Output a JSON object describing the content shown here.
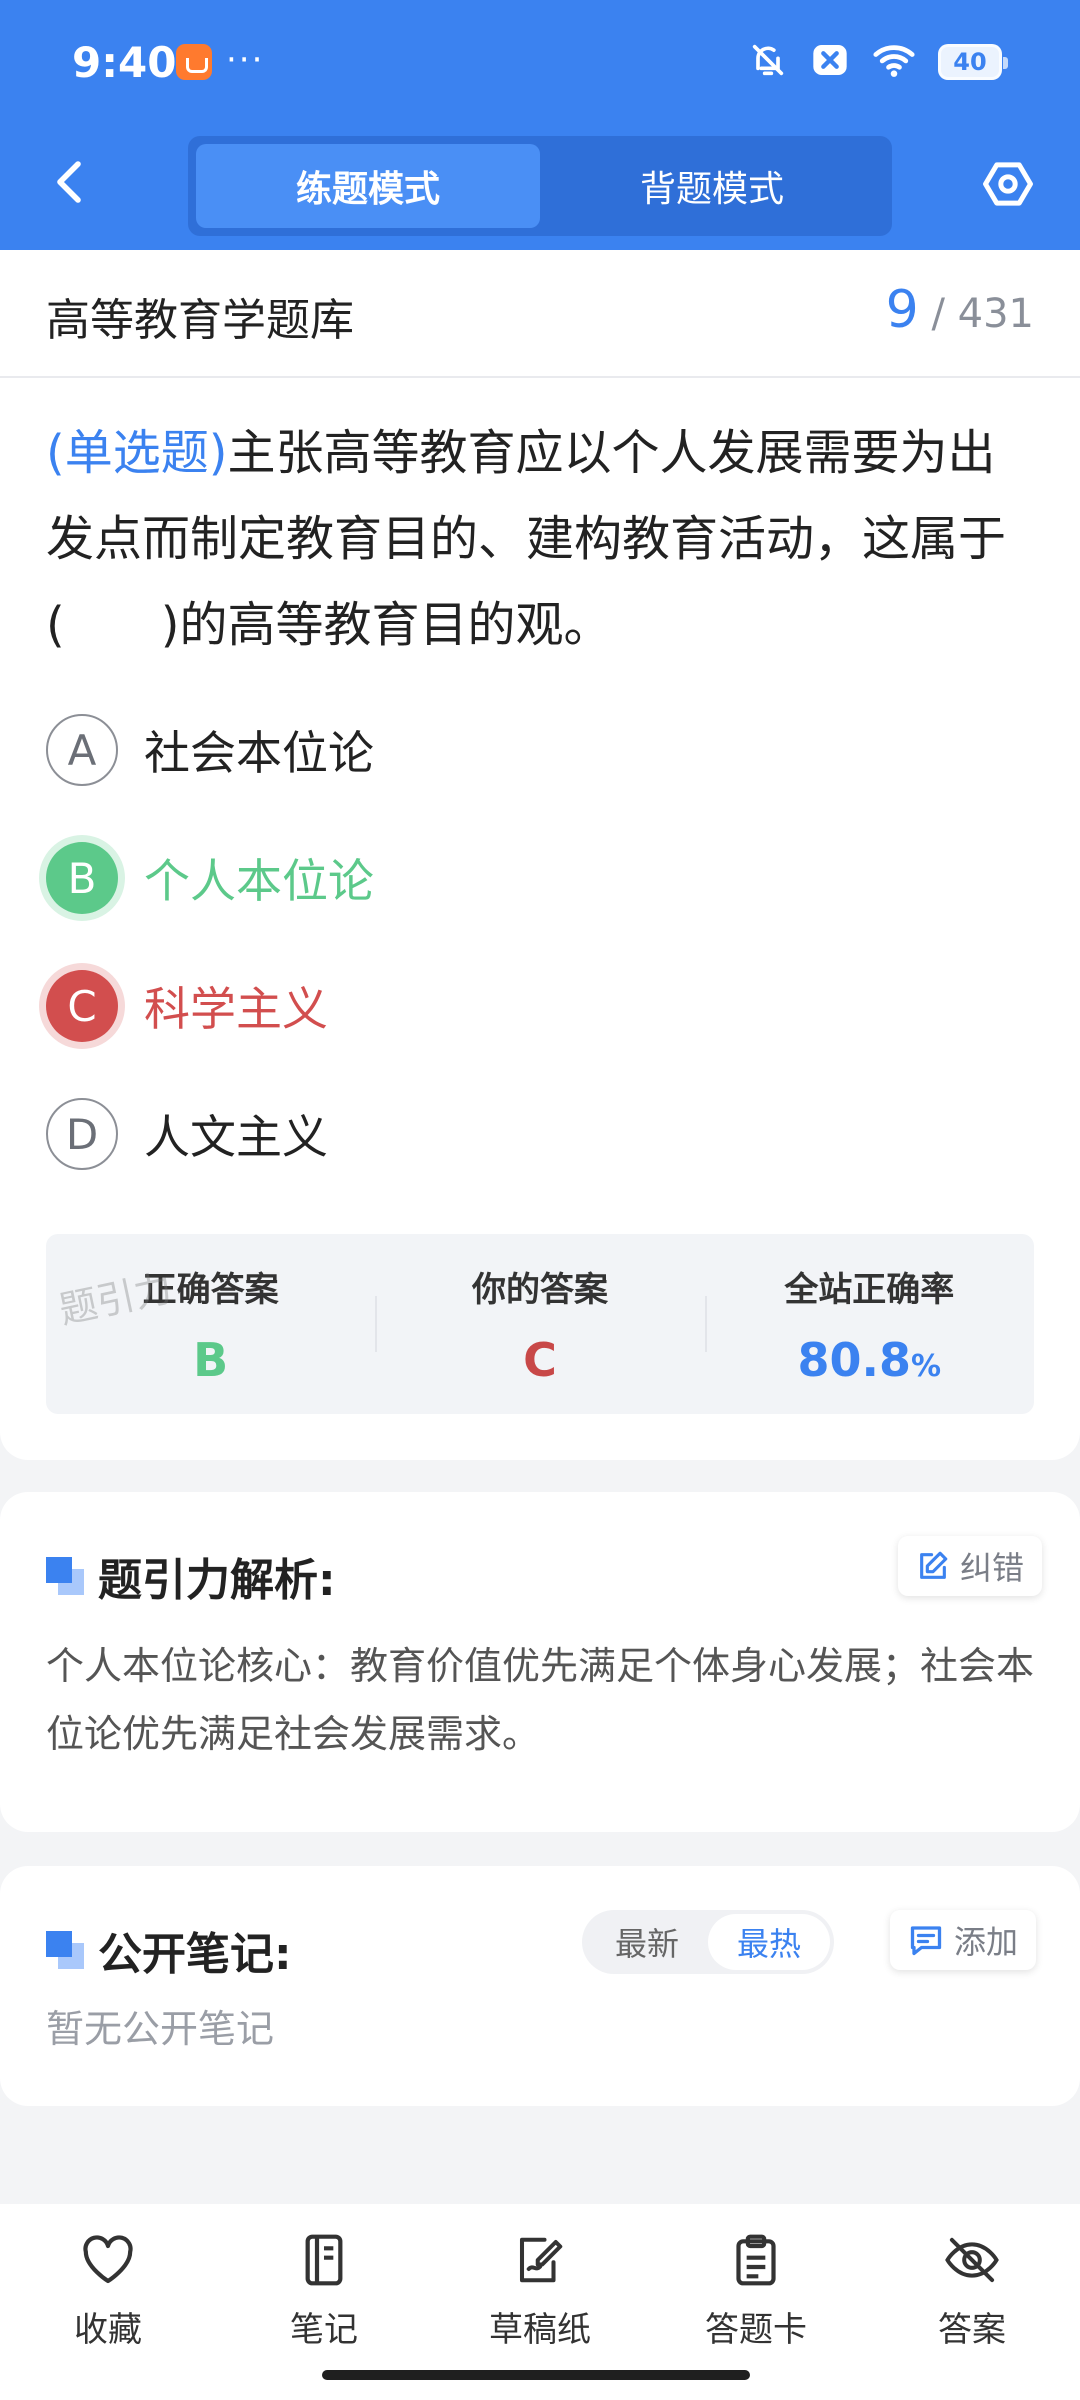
{
  "status_bar": {
    "time": "9:40",
    "dots": "···",
    "battery": "40"
  },
  "nav": {
    "back_icon": "chevron-left-icon",
    "modes": [
      {
        "label": "练题模式",
        "active": true
      },
      {
        "label": "背题模式",
        "active": false
      }
    ],
    "settings_icon": "hexagon-settings-icon"
  },
  "bank": {
    "title": "高等教育学题库",
    "current": "9",
    "separator": "/",
    "total": "431"
  },
  "question": {
    "type": "(单选题)",
    "text": "主张高等教育应以个人发展需要为出发点而制定教育目的、建构教育活动，这属于(　　)的高等教育目的观。"
  },
  "options": [
    {
      "letter": "A",
      "text": "社会本位论",
      "state": "normal"
    },
    {
      "letter": "B",
      "text": "个人本位论",
      "state": "correct"
    },
    {
      "letter": "C",
      "text": "科学主义",
      "state": "wrong"
    },
    {
      "letter": "D",
      "text": "人文主义",
      "state": "normal"
    }
  ],
  "stats": {
    "watermark": "题引力",
    "correct_label": "正确答案",
    "correct_value": "B",
    "yours_label": "你的答案",
    "yours_value": "C",
    "rate_label": "全站正确率",
    "rate_value": "80.8",
    "rate_unit": "%"
  },
  "analysis": {
    "title": "题引力解析:",
    "correct_btn": "纠错",
    "text": "个人本位论核心：教育价值优先满足个体身心发展；社会本位论优先满足社会发展需求。"
  },
  "notes": {
    "title": "公开笔记:",
    "sort": [
      {
        "label": "最新",
        "active": false
      },
      {
        "label": "最热",
        "active": true
      }
    ],
    "add_btn": "添加",
    "empty": "暂无公开笔记"
  },
  "toolbar": [
    {
      "label": "收藏",
      "icon": "heart-icon"
    },
    {
      "label": "笔记",
      "icon": "notebook-icon"
    },
    {
      "label": "草稿纸",
      "icon": "draft-paper-icon"
    },
    {
      "label": "答题卡",
      "icon": "answer-sheet-icon"
    },
    {
      "label": "答案",
      "icon": "eye-off-icon"
    }
  ],
  "colors": {
    "primary": "#3b82f0",
    "correct": "#5cc98a",
    "wrong": "#d24e4e"
  }
}
